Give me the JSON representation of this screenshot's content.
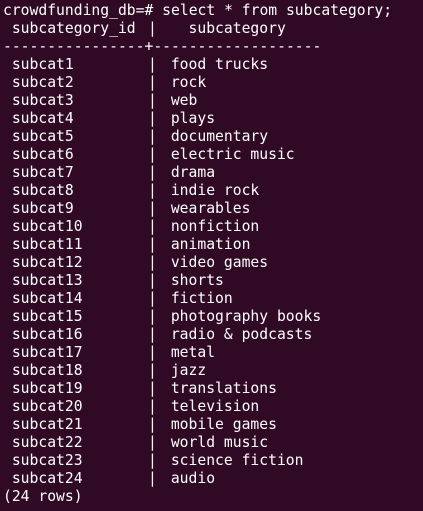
{
  "prompt": "crowdfunding_db=#",
  "command": "select * from subcategory;",
  "columns": [
    "subcategory_id",
    "subcategory"
  ],
  "divider": "----------------+-------------------",
  "rows": [
    [
      "subcat1",
      "food trucks"
    ],
    [
      "subcat2",
      "rock"
    ],
    [
      "subcat3",
      "web"
    ],
    [
      "subcat4",
      "plays"
    ],
    [
      "subcat5",
      "documentary"
    ],
    [
      "subcat6",
      "electric music"
    ],
    [
      "subcat7",
      "drama"
    ],
    [
      "subcat8",
      "indie rock"
    ],
    [
      "subcat9",
      "wearables"
    ],
    [
      "subcat10",
      "nonfiction"
    ],
    [
      "subcat11",
      "animation"
    ],
    [
      "subcat12",
      "video games"
    ],
    [
      "subcat13",
      "shorts"
    ],
    [
      "subcat14",
      "fiction"
    ],
    [
      "subcat15",
      "photography books"
    ],
    [
      "subcat16",
      "radio & podcasts"
    ],
    [
      "subcat17",
      "metal"
    ],
    [
      "subcat18",
      "jazz"
    ],
    [
      "subcat19",
      "translations"
    ],
    [
      "subcat20",
      "television"
    ],
    [
      "subcat21",
      "mobile games"
    ],
    [
      "subcat22",
      "world music"
    ],
    [
      "subcat23",
      "science fiction"
    ],
    [
      "subcat24",
      "audio"
    ]
  ],
  "row_count": "(24 rows)",
  "colors": {
    "background": "#300a24",
    "text": "#ffffff"
  }
}
